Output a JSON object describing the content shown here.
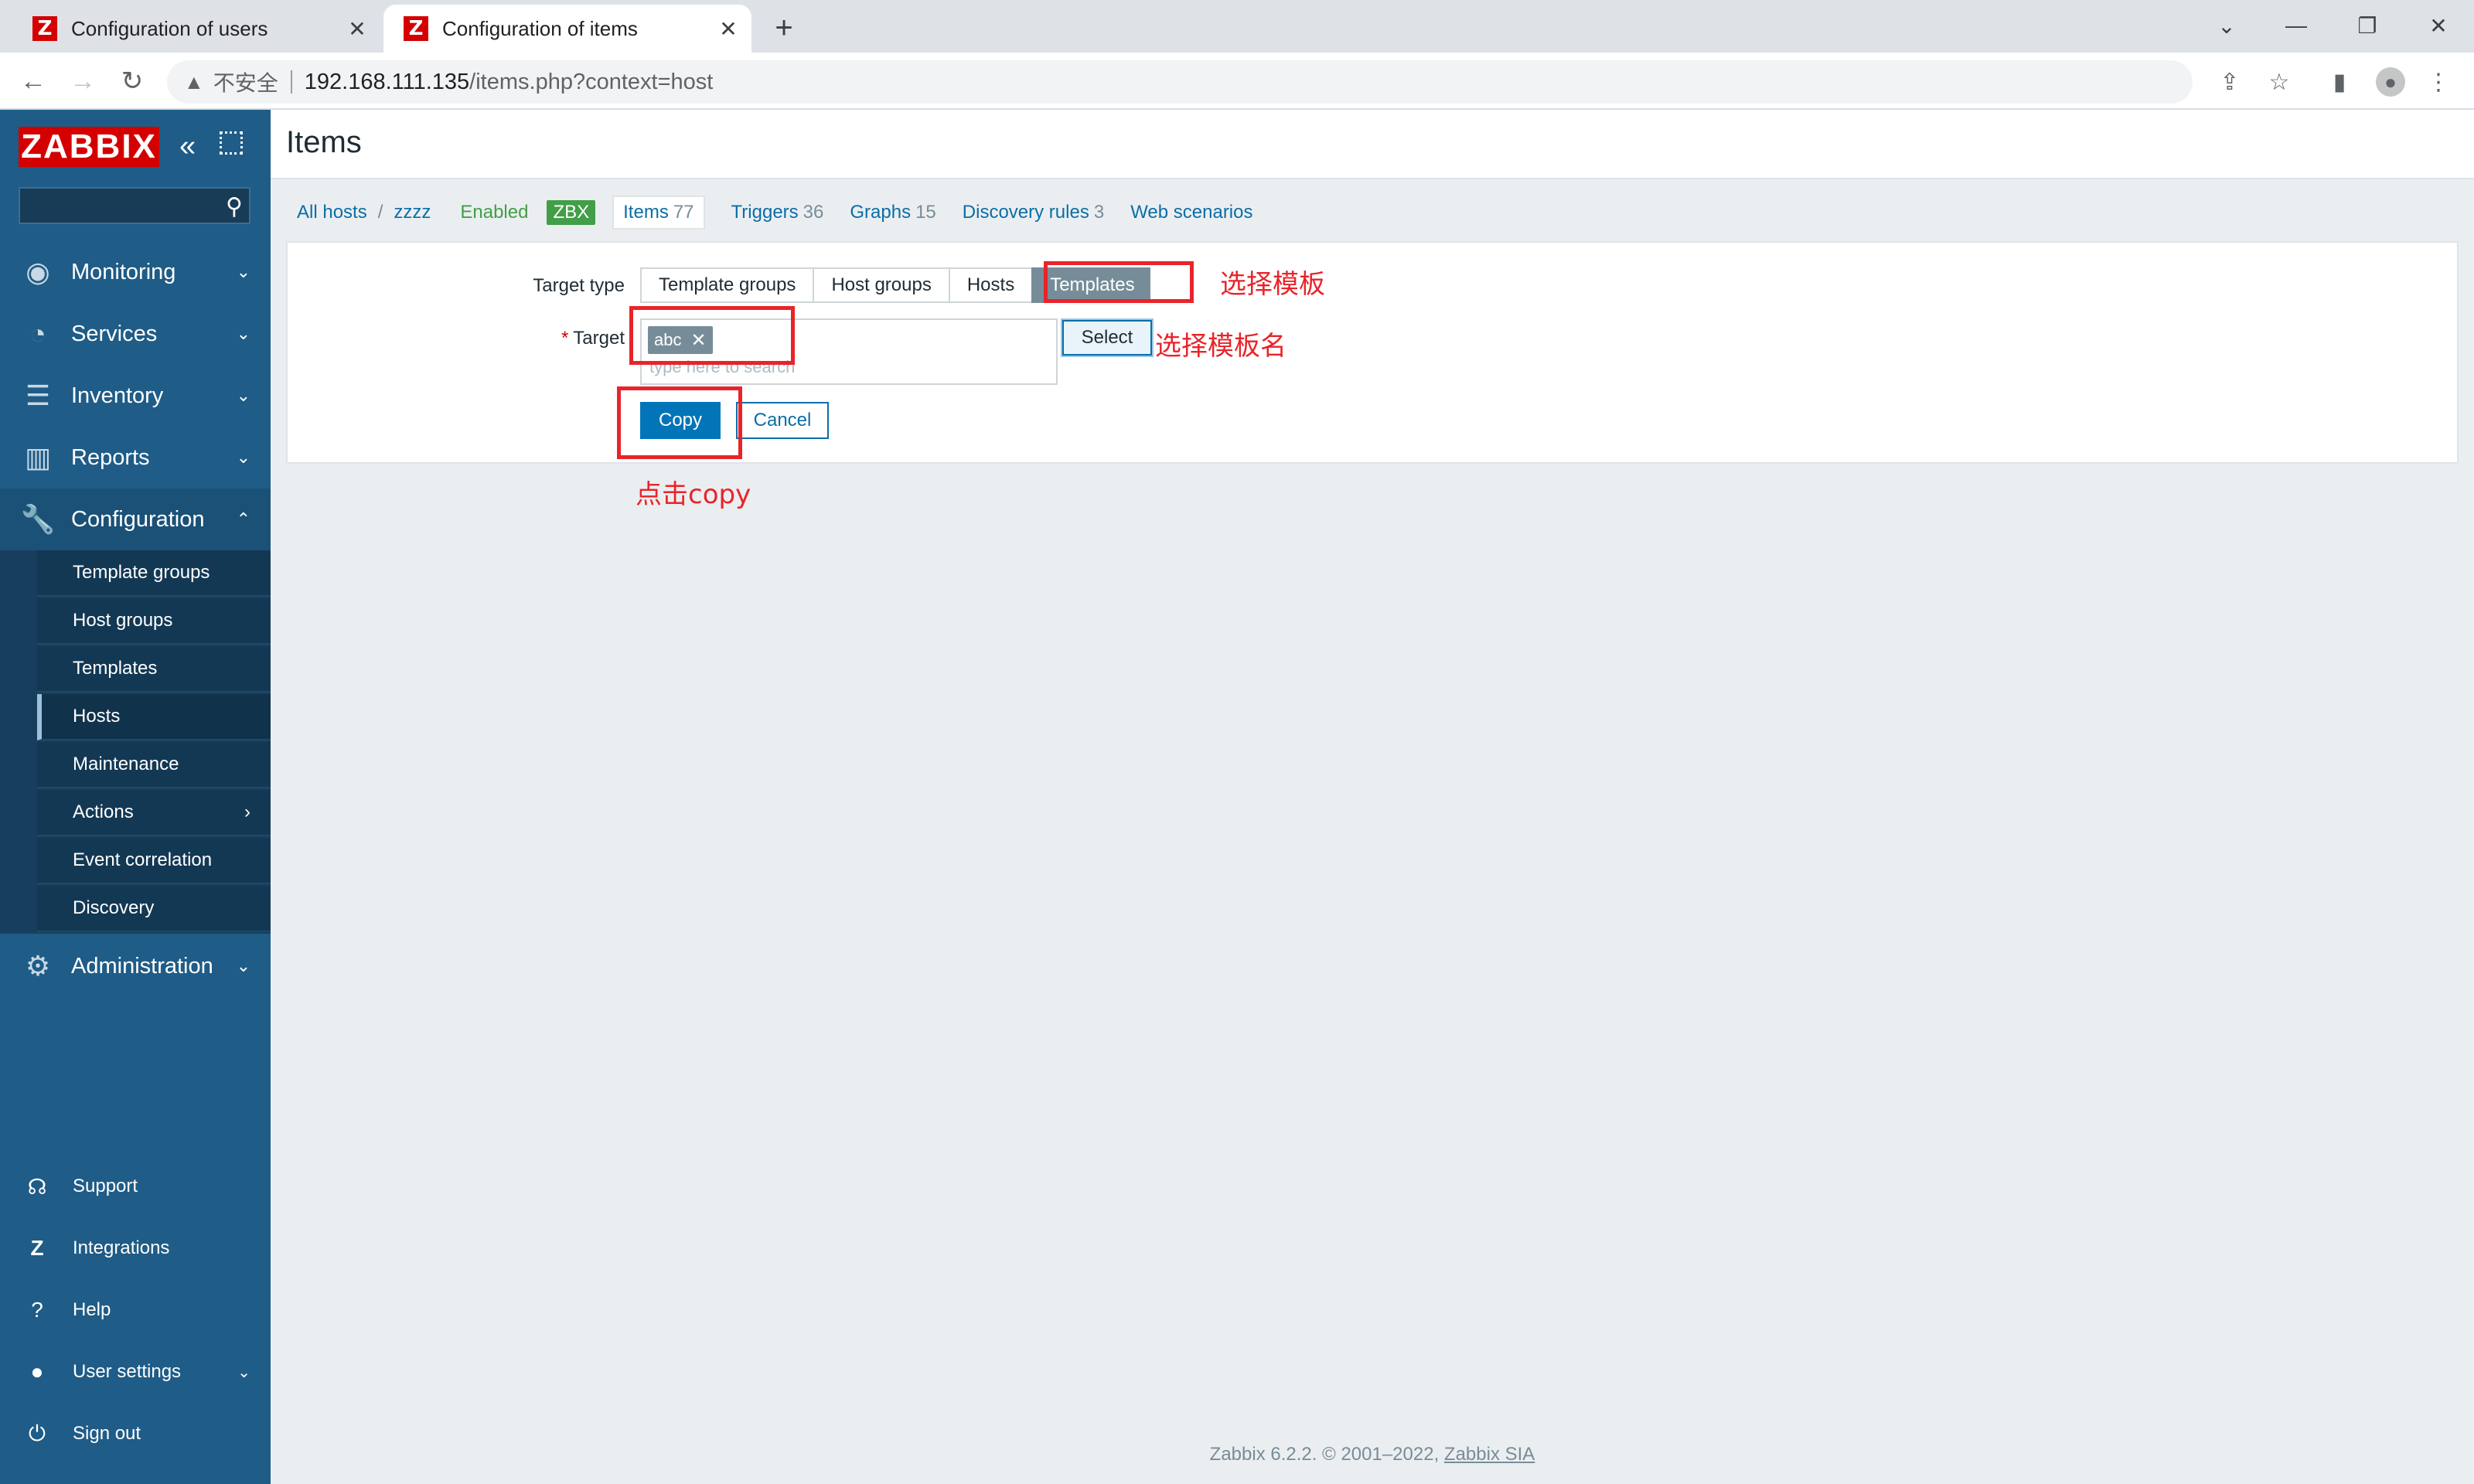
{
  "browser": {
    "tabs": [
      {
        "title": "Configuration of users",
        "active": false
      },
      {
        "title": "Configuration of items",
        "active": true
      }
    ],
    "new_tab": "+",
    "insecure_label": "不安全",
    "url_host": "192.168.111.135",
    "url_path": "/items.php?context=host"
  },
  "sidebar": {
    "logo": "ZABBIX",
    "nav": [
      {
        "label": "Monitoring",
        "icon": "eye-icon"
      },
      {
        "label": "Services",
        "icon": "stopwatch-icon"
      },
      {
        "label": "Inventory",
        "icon": "list-icon"
      },
      {
        "label": "Reports",
        "icon": "bar-chart-icon"
      },
      {
        "label": "Configuration",
        "icon": "wrench-icon"
      }
    ],
    "config_submenu": [
      {
        "label": "Template groups"
      },
      {
        "label": "Host groups"
      },
      {
        "label": "Templates"
      },
      {
        "label": "Hosts",
        "selected": true
      },
      {
        "label": "Maintenance"
      },
      {
        "label": "Actions"
      },
      {
        "label": "Event correlation"
      },
      {
        "label": "Discovery"
      }
    ],
    "admin": {
      "label": "Administration",
      "icon": "gear-icon"
    },
    "utility": [
      {
        "label": "Support",
        "icon": "headset-icon"
      },
      {
        "label": "Integrations",
        "icon": "zabbix-z-icon"
      },
      {
        "label": "Help",
        "icon": "question-icon"
      },
      {
        "label": "User settings",
        "icon": "user-icon"
      },
      {
        "label": "Sign out",
        "icon": "power-icon"
      }
    ]
  },
  "page": {
    "title": "Items",
    "breadcrumbs": {
      "all_hosts": "All hosts",
      "separator": "/",
      "host": "zzzz",
      "status": "Enabled",
      "badge": "ZBX",
      "tabs": [
        {
          "label": "Items",
          "count": "77"
        },
        {
          "label": "Triggers",
          "count": "36"
        },
        {
          "label": "Graphs",
          "count": "15"
        },
        {
          "label": "Discovery rules",
          "count": "3"
        },
        {
          "label": "Web scenarios",
          "count": ""
        }
      ]
    },
    "form": {
      "target_type_label": "Target type",
      "target_type_options": [
        "Template groups",
        "Host groups",
        "Hosts",
        "Templates"
      ],
      "target_type_selected": "Templates",
      "required_mark": "*",
      "target_label": "Target",
      "target_chip": "abc",
      "target_placeholder": "type here to search",
      "select_button": "Select",
      "copy_button": "Copy",
      "cancel_button": "Cancel"
    }
  },
  "annotations": {
    "templates_note": "选择模板",
    "template_name_note": "选择模板名",
    "copy_note": "点击copy",
    "color": "#e8242a"
  },
  "footer": {
    "text": "Zabbix 6.2.2. © 2001–2022,",
    "link": "Zabbix SIA"
  },
  "colors": {
    "sidebar": "#1f5c87",
    "accent": "#0275b8",
    "brand_red": "#d40000",
    "badge_green": "#429e47"
  }
}
